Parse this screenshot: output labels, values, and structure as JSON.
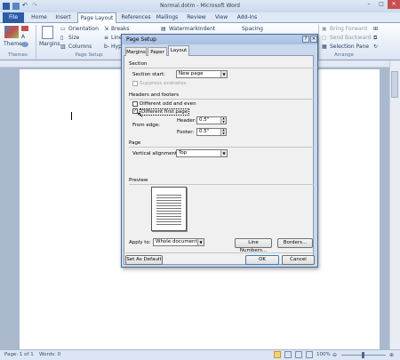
{
  "window": {
    "title": "Normal.dotm - Microsoft Word"
  },
  "tabs": [
    "File",
    "Home",
    "Insert",
    "Page Layout",
    "References",
    "Mailings",
    "Review",
    "View",
    "Add-Ins"
  ],
  "ribbon": {
    "themes_label": "Themes",
    "margins_label": "Margins",
    "orientation_label": "Orientation",
    "size_label": "Size",
    "columns_label": "Columns",
    "breaks_label": "Breaks",
    "line_label": "Line",
    "hyph_label": "Hyph",
    "watermark_label": "Watermark",
    "indent_label": "Indent",
    "spacing_label": "Spacing",
    "bring_forward_label": "Bring Forward",
    "send_backward_label": "Send Backward",
    "selection_pane_label": "Selection Pane",
    "groups": {
      "themes": "Themes",
      "page_setup": "Page Setup",
      "arrange": "Arrange"
    }
  },
  "dialog": {
    "title": "Page Setup",
    "tabs": [
      "Margins",
      "Paper",
      "Layout"
    ],
    "section": {
      "heading": "Section",
      "section_start_label": "Section start:",
      "section_start_value": "New page",
      "suppress_endnotes_label": "Suppress endnotes"
    },
    "headers_footers": {
      "heading": "Headers and footers",
      "odd_even_label": "Different odd and even",
      "first_page_label": "Different first page",
      "from_edge_label": "From edge:",
      "header_label": "Header:",
      "header_value": "0.5\"",
      "footer_label": "Footer:",
      "footer_value": "0.5\""
    },
    "page": {
      "heading": "Page",
      "vertical_alignment_label": "Vertical alignment:",
      "vertical_alignment_value": "Top"
    },
    "preview": {
      "heading": "Preview",
      "apply_to_label": "Apply to:",
      "apply_to_value": "Whole document",
      "line_numbers_label": "Line Numbers...",
      "borders_label": "Borders..."
    },
    "buttons": {
      "set_as_default": "Set As Default",
      "ok": "OK",
      "cancel": "Cancel"
    }
  },
  "status": {
    "page": "Page: 1 of 1",
    "words": "Words: 0",
    "zoom": "100%"
  }
}
